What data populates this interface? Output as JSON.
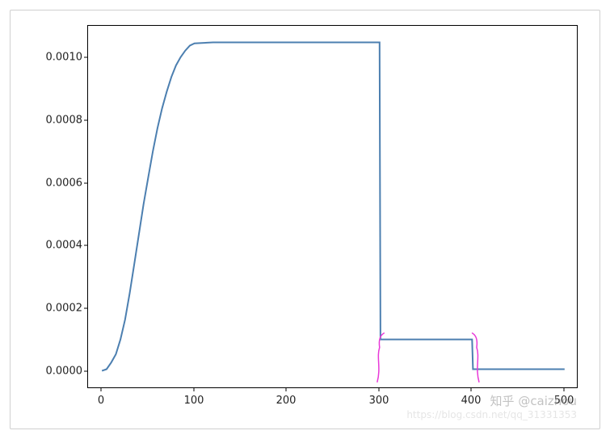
{
  "chart_data": {
    "type": "line",
    "title": "",
    "xlabel": "",
    "ylabel": "",
    "xlim": [
      -15,
      515
    ],
    "ylim": [
      -5e-05,
      0.00105
    ],
    "x_ticks": [
      0,
      100,
      200,
      300,
      400,
      500
    ],
    "y_ticks": [
      0.0,
      0.0002,
      0.0004,
      0.0006,
      0.0008,
      0.001
    ],
    "y_tick_labels": [
      "0.0000",
      "0.0002",
      "0.0004",
      "0.0006",
      "0.0008",
      "0.0010"
    ],
    "x": [
      0,
      5,
      10,
      15,
      20,
      25,
      30,
      35,
      40,
      45,
      50,
      55,
      60,
      65,
      70,
      75,
      80,
      85,
      90,
      95,
      100,
      120,
      150,
      200,
      250,
      300,
      301,
      350,
      400,
      401,
      450,
      500
    ],
    "y": [
      5e-06,
      1e-05,
      3e-05,
      5.5e-05,
      0.0001,
      0.00016,
      0.00024,
      0.00033,
      0.00042,
      0.00051,
      0.00059,
      0.00067,
      0.00074,
      0.0008,
      0.00085,
      0.000895,
      0.00093,
      0.000955,
      0.000975,
      0.00099,
      0.000997,
      0.001,
      0.001,
      0.001,
      0.001,
      0.001,
      0.0001,
      0.0001,
      0.0001,
      1e-05,
      1e-05,
      1e-05
    ],
    "line_color": "#4c7fb0",
    "annotations": [
      {
        "kind": "bracket",
        "x_range": [
          300,
          405
        ],
        "note": "hand-drawn pink brackets highlighting the lower plateau segment"
      }
    ]
  },
  "watermarks": {
    "line1": "知乎 @caizhou",
    "line2": "https://blog.csdn.net/qq_31331353"
  }
}
